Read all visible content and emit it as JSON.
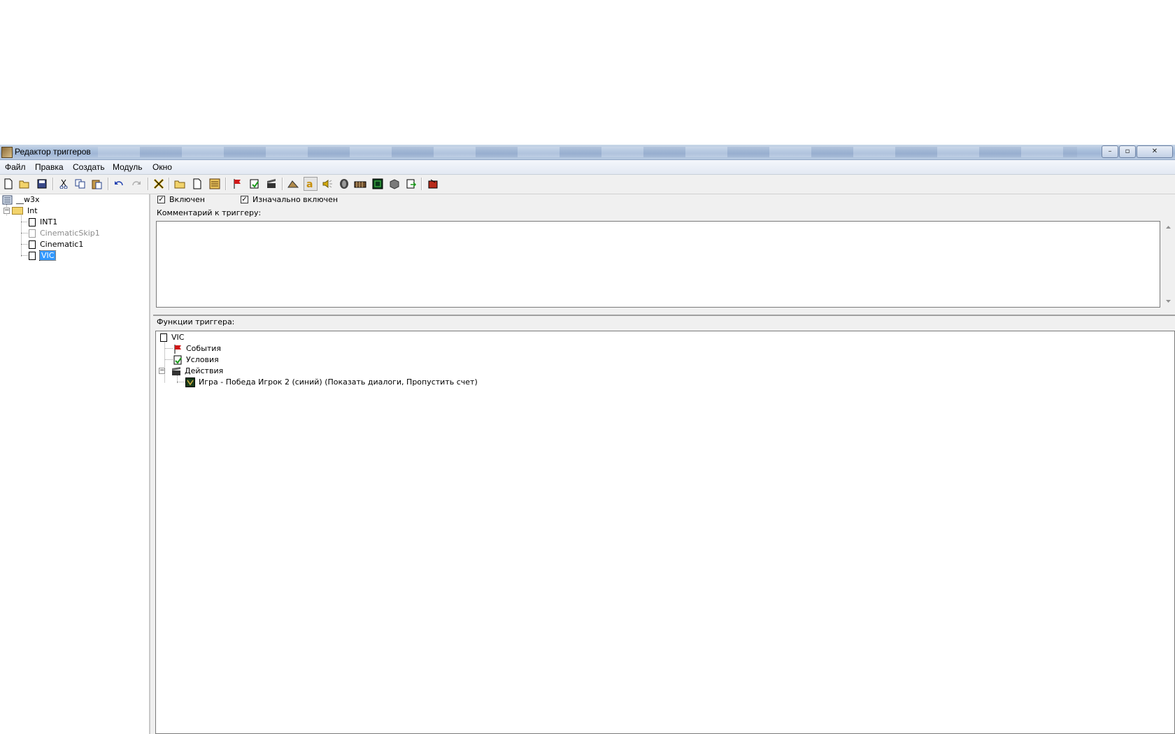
{
  "window": {
    "title": "Редактор триггеров",
    "controls": {
      "minimize": "–",
      "maximize": "▫",
      "close": "✕"
    }
  },
  "menu": [
    "Файл",
    "Правка",
    "Создать",
    "Модуль",
    "Окно"
  ],
  "toolbar_icons": [
    "new-icon",
    "open-icon",
    "save-icon",
    "cut-icon",
    "copy-icon",
    "paste-icon",
    "undo-icon",
    "redo-icon",
    "delete-icon",
    "new-category-icon",
    "new-trigger-icon",
    "new-comment-icon",
    "new-event-icon",
    "new-condition-icon",
    "new-action-icon",
    "terrain-editor-icon",
    "trigger-editor-icon",
    "sound-editor-icon",
    "object-editor-icon",
    "campaign-editor-icon",
    "ai-editor-icon",
    "import-manager-icon",
    "module-icon",
    "test-map-icon"
  ],
  "left_tree": {
    "root": "__w3x",
    "category": "Int",
    "triggers": [
      {
        "label": "INT1",
        "disabled": false,
        "selected": false
      },
      {
        "label": "CinematicSkip1",
        "disabled": true,
        "selected": false
      },
      {
        "label": "Cinematic1",
        "disabled": false,
        "selected": false
      },
      {
        "label": "VIC",
        "disabled": false,
        "selected": true
      }
    ]
  },
  "trigger": {
    "enabled_label": "Включен",
    "enabled": true,
    "initially_on_label": "Изначально включен",
    "initially_on": true,
    "comment_label": "Комментарий к триггеру:",
    "comment_text": "",
    "functions_label": "Функции триггера:",
    "functions": {
      "name": "VIC",
      "events_label": "События",
      "conditions_label": "Условия",
      "actions_label": "Действия",
      "actions": [
        "Игра - Победа Игрок 2 (синий) (Показать диалоги, Пропустить счет)"
      ]
    }
  },
  "colors": {
    "selection": "#3399ff",
    "disabled_text": "#8c8c8c"
  }
}
